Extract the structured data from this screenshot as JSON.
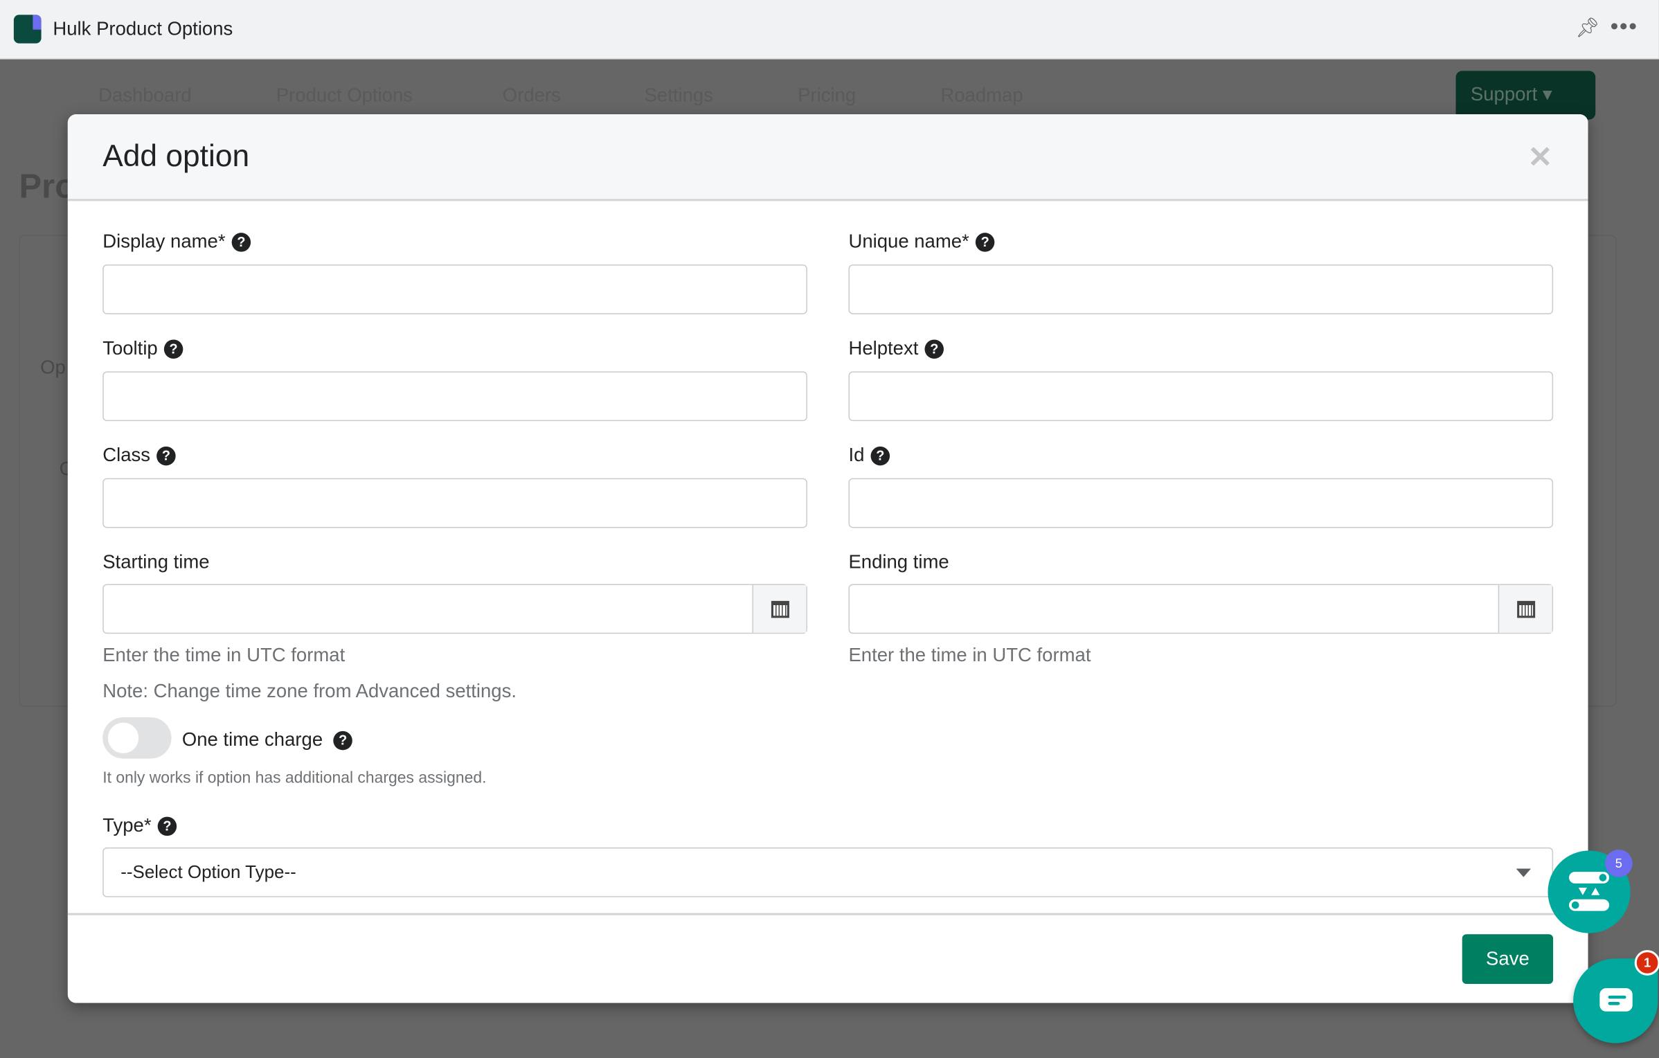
{
  "app": {
    "title": "Hulk Product Options"
  },
  "nav": {
    "items": [
      "Dashboard",
      "Product Options",
      "Orders",
      "Settings",
      "Pricing",
      "Roadmap"
    ],
    "support_label": "Support"
  },
  "background": {
    "page_title_partial": "Pro",
    "tab_partial": "Op",
    "card_partial": "C"
  },
  "modal": {
    "title": "Add option",
    "fields": {
      "display_name": {
        "label": "Display name*",
        "value": ""
      },
      "unique_name": {
        "label": "Unique name*",
        "value": ""
      },
      "tooltip": {
        "label": "Tooltip",
        "value": ""
      },
      "helptext": {
        "label": "Helptext",
        "value": ""
      },
      "class": {
        "label": "Class",
        "value": ""
      },
      "id": {
        "label": "Id",
        "value": ""
      },
      "starting_time": {
        "label": "Starting time",
        "value": "",
        "help": "Enter the time in UTC format"
      },
      "ending_time": {
        "label": "Ending time",
        "value": "",
        "help": "Enter the time in UTC format"
      }
    },
    "note": "Note: Change time zone from Advanced settings.",
    "one_time_charge": {
      "label": "One time charge",
      "enabled": false,
      "help": "It only works if option has additional charges assigned."
    },
    "type": {
      "label": "Type*",
      "selected": "--Select Option Type--"
    },
    "save_label": "Save"
  },
  "widgets": {
    "options_badge": "5",
    "chat_badge": "1"
  },
  "colors": {
    "primary": "#008060",
    "fab": "#00a89e",
    "badge_purple": "#6b6cf0",
    "badge_red": "#d82c0d"
  }
}
